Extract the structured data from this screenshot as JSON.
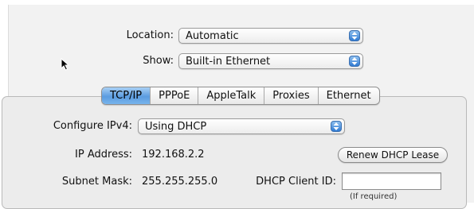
{
  "location": {
    "label": "Location:",
    "value": "Automatic"
  },
  "show": {
    "label": "Show:",
    "value": "Built-in Ethernet"
  },
  "tabs": [
    {
      "label": "TCP/IP",
      "selected": true
    },
    {
      "label": "PPPoE",
      "selected": false
    },
    {
      "label": "AppleTalk",
      "selected": false
    },
    {
      "label": "Proxies",
      "selected": false
    },
    {
      "label": "Ethernet",
      "selected": false
    }
  ],
  "configure_ipv4": {
    "label": "Configure IPv4:",
    "value": "Using DHCP"
  },
  "ip_address": {
    "label": "IP Address:",
    "value": "192.168.2.2"
  },
  "subnet_mask": {
    "label": "Subnet Mask:",
    "value": "255.255.255.0"
  },
  "renew_button": {
    "label": "Renew DHCP Lease"
  },
  "dhcp_client_id": {
    "label": "DHCP Client ID:",
    "value": "",
    "hint": "(If required)"
  },
  "colors": {
    "accent": "#5b9ce0",
    "popup_arrow": "#2f7ad3"
  },
  "icons": {
    "popup_arrows": "up-down-arrows-icon",
    "cursor": "mouse-pointer-icon"
  }
}
